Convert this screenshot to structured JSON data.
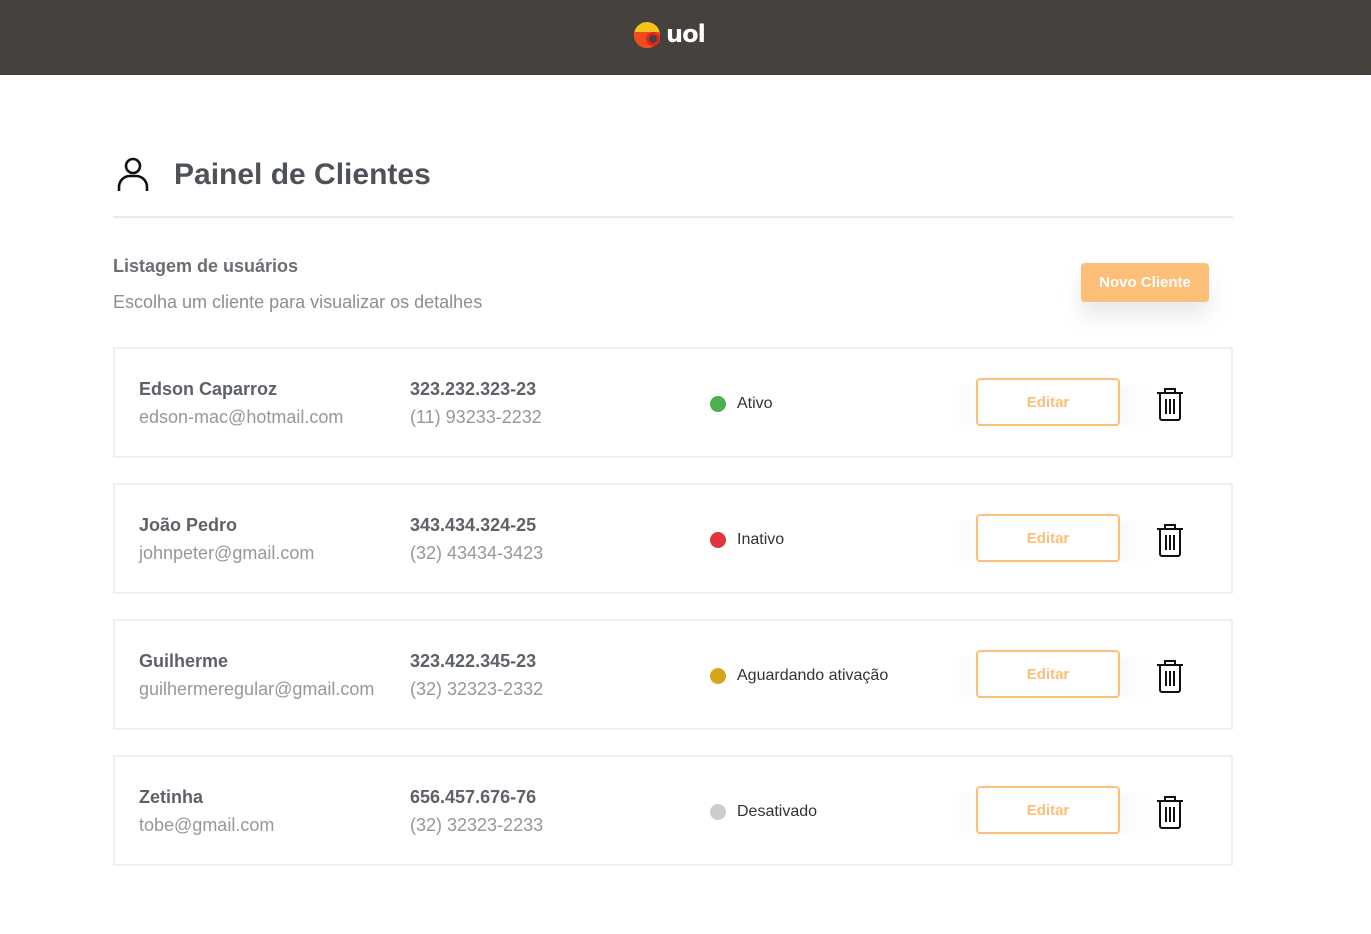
{
  "header": {
    "logo_text": "uol"
  },
  "panel": {
    "title": "Painel de Clientes",
    "list_title": "Listagem de usuários",
    "list_subtitle": "Escolha um cliente para visualizar os detalhes",
    "new_client_label": "Novo Cliente"
  },
  "colors": {
    "topbar": "#45413c",
    "accent": "#fdbe78",
    "status_active": "#4caf50",
    "status_inactive": "#e0343f",
    "status_pending": "#d4a61a",
    "status_disabled": "#cccccc"
  },
  "clients": [
    {
      "name": "Edson Caparroz",
      "email": "edson-mac@hotmail.com",
      "cpf": "323.232.323-23",
      "phone": "(11) 93233-2232",
      "status": "Ativo",
      "status_color": "#4caf50",
      "edit_label": "Editar",
      "delete_icon": "trash-icon"
    },
    {
      "name": "João Pedro",
      "email": "johnpeter@gmail.com",
      "cpf": "343.434.324-25",
      "phone": "(32) 43434-3423",
      "status": "Inativo",
      "status_color": "#e0343f",
      "edit_label": "Editar",
      "delete_icon": "trash-icon"
    },
    {
      "name": "Guilherme",
      "email": "guilhermeregular@gmail.com",
      "cpf": "323.422.345-23",
      "phone": "(32) 32323-2332",
      "status": "Aguardando ativação",
      "status_color": "#d4a61a",
      "edit_label": "Editar",
      "delete_icon": "trash-icon"
    },
    {
      "name": "Zetinha",
      "email": "tobe@gmail.com",
      "cpf": "656.457.676-76",
      "phone": "(32) 32323-2233",
      "status": "Desativado",
      "status_color": "#cccccc",
      "edit_label": "Editar",
      "delete_icon": "trash-icon"
    }
  ]
}
